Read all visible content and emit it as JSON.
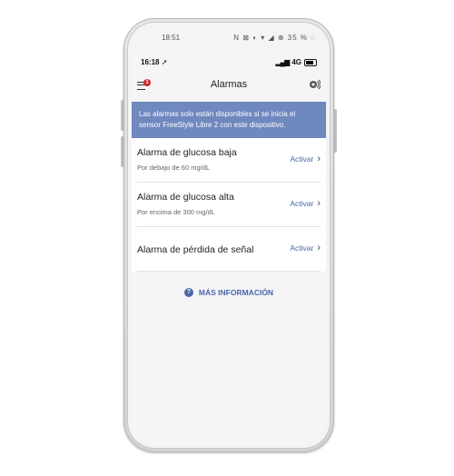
{
  "outer_status": {
    "time": "18:51",
    "icons": "N ⊠ ◐ ▾ ◢ ⊕ 35 % ◌"
  },
  "ios_status": {
    "time": "16:18",
    "location_icon": "➚",
    "network": "4G"
  },
  "header": {
    "title": "Alarmas",
    "badge_count": "1",
    "menu_icon": "menu-icon",
    "sound_icon": "sound-icon"
  },
  "banner": {
    "text": "Las alarmas solo están disponibles si se inicia el sensor FreeStyle Libre 2 con este dispositivo.",
    "color": "#6f88be"
  },
  "alarms": [
    {
      "title": "Alarma de glucosa baja",
      "subtitle": "Por debajo de 60 mg/dL",
      "action": "Activar"
    },
    {
      "title": "Alarma de glucosa alta",
      "subtitle": "Por encima de 300 mg/dL",
      "action": "Activar"
    },
    {
      "title": "Alarma de pérdida de señal",
      "subtitle": "",
      "action": "Activar"
    }
  ],
  "more_info": {
    "label": "MÁS INFORMACIÓN",
    "icon": "?"
  },
  "colors": {
    "accent": "#4a67a8",
    "badge": "#c62828"
  }
}
